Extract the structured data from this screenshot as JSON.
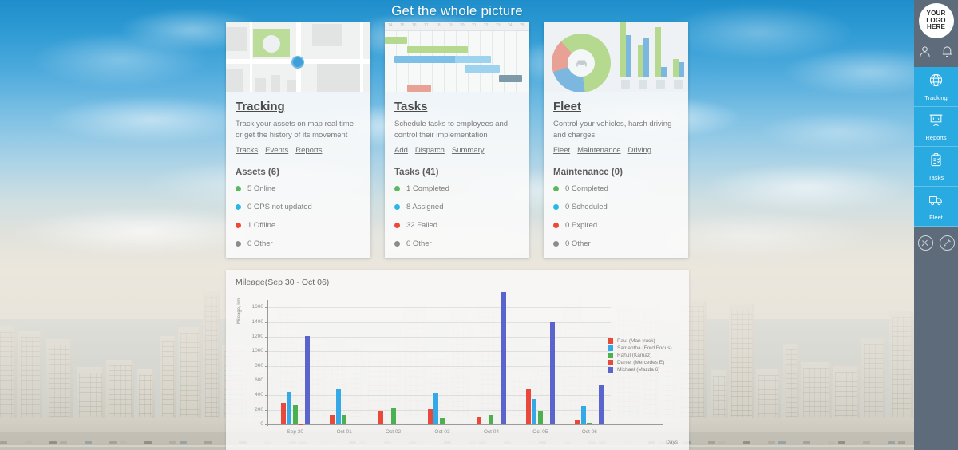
{
  "headline": "Get the whole picture",
  "cards": [
    {
      "title": "Tracking",
      "description": "Track your assets on map real time or get the history of its movement",
      "links": [
        "Tracks",
        "Events",
        "Reports"
      ],
      "thumb": "map-thumbnail",
      "stat_title": "Assets (6)",
      "stats": [
        {
          "label": "5 Online",
          "color": "#5cb85c"
        },
        {
          "label": "0 GPS not updated",
          "color": "#29b6e8"
        },
        {
          "label": "1 Offline",
          "color": "#ef4836"
        },
        {
          "label": "0 Other",
          "color": "#8c8c8c"
        }
      ]
    },
    {
      "title": "Tasks",
      "description": "Schedule tasks to employees and control their implementation",
      "links": [
        "Add",
        "Dispatch",
        "Summary"
      ],
      "thumb": "gantt-thumbnail",
      "stat_title": "Tasks (41)",
      "stats": [
        {
          "label": "1 Completed",
          "color": "#5cb85c"
        },
        {
          "label": "8 Assigned",
          "color": "#29b6e8"
        },
        {
          "label": "32 Failed",
          "color": "#ef4836"
        },
        {
          "label": "0 Other",
          "color": "#8c8c8c"
        }
      ]
    },
    {
      "title": "Fleet",
      "description": "Control your vehicles, harsh driving and charges",
      "links": [
        "Fleet",
        "Maintenance",
        "Driving"
      ],
      "thumb": "fleet-thumbnail",
      "stat_title": "Maintenance (0)",
      "stats": [
        {
          "label": "0 Completed",
          "color": "#5cb85c"
        },
        {
          "label": "0 Scheduled",
          "color": "#29b6e8"
        },
        {
          "label": "0 Expired",
          "color": "#ef4836"
        },
        {
          "label": "0 Other",
          "color": "#8c8c8c"
        }
      ]
    }
  ],
  "gantt_thumb": {
    "column_numbers": [
      "14",
      "15",
      "16",
      "17",
      "18",
      "19",
      "20",
      "21",
      "22",
      "23",
      "24",
      "25"
    ]
  },
  "chart_data": {
    "type": "bar",
    "title": "Mileage(Sep 30 - Oct 06)",
    "xlabel": "Days",
    "ylabel": "Mileage, km",
    "ylim": [
      0,
      1700
    ],
    "yticks": [
      0,
      200,
      400,
      600,
      800,
      1000,
      1200,
      1400,
      1600
    ],
    "grid": true,
    "legend_position": "right",
    "categories": [
      "Sep 30",
      "Oct 01",
      "Oct 02",
      "Oct 03",
      "Oct 04",
      "Oct 05",
      "Oct 06"
    ],
    "series": [
      {
        "name": "Paul (Man truck)",
        "color": "#e8493a",
        "values": [
          290,
          130,
          180,
          210,
          100,
          480,
          70
        ]
      },
      {
        "name": "Samantha (Ford Focus)",
        "color": "#33a9e8",
        "values": [
          450,
          490,
          0,
          430,
          0,
          345,
          255
        ]
      },
      {
        "name": "Rahul (Kamaz)",
        "color": "#4cb050",
        "values": [
          270,
          135,
          230,
          90,
          130,
          185,
          20
        ]
      },
      {
        "name": "Daniel (Mercedes E)",
        "color": "#e8493a",
        "values": [
          5,
          0,
          0,
          15,
          0,
          0,
          0
        ]
      },
      {
        "name": "Michael (Mazda 6)",
        "color": "#5b63cc",
        "values": [
          1205,
          0,
          0,
          0,
          1810,
          1390,
          540
        ]
      }
    ]
  },
  "sidebar": {
    "logo_lines": [
      "YOUR",
      "LOGO",
      "HERE"
    ],
    "top_icons": [
      {
        "name": "user-icon"
      },
      {
        "name": "bell-icon"
      }
    ],
    "nav": [
      {
        "label": "Tracking",
        "icon": "globe-icon"
      },
      {
        "label": "Reports",
        "icon": "presentation-chart-icon"
      },
      {
        "label": "Tasks",
        "icon": "clipboard-check-icon"
      },
      {
        "label": "Fleet",
        "icon": "truck-icon"
      }
    ],
    "bottom_icons": [
      {
        "name": "tools-icon"
      },
      {
        "name": "screwdriver-icon"
      }
    ]
  },
  "colors": {
    "accent": "#29aae1",
    "sidebar_bg": "#5d6b7a",
    "sky": "#1e8ecb"
  }
}
